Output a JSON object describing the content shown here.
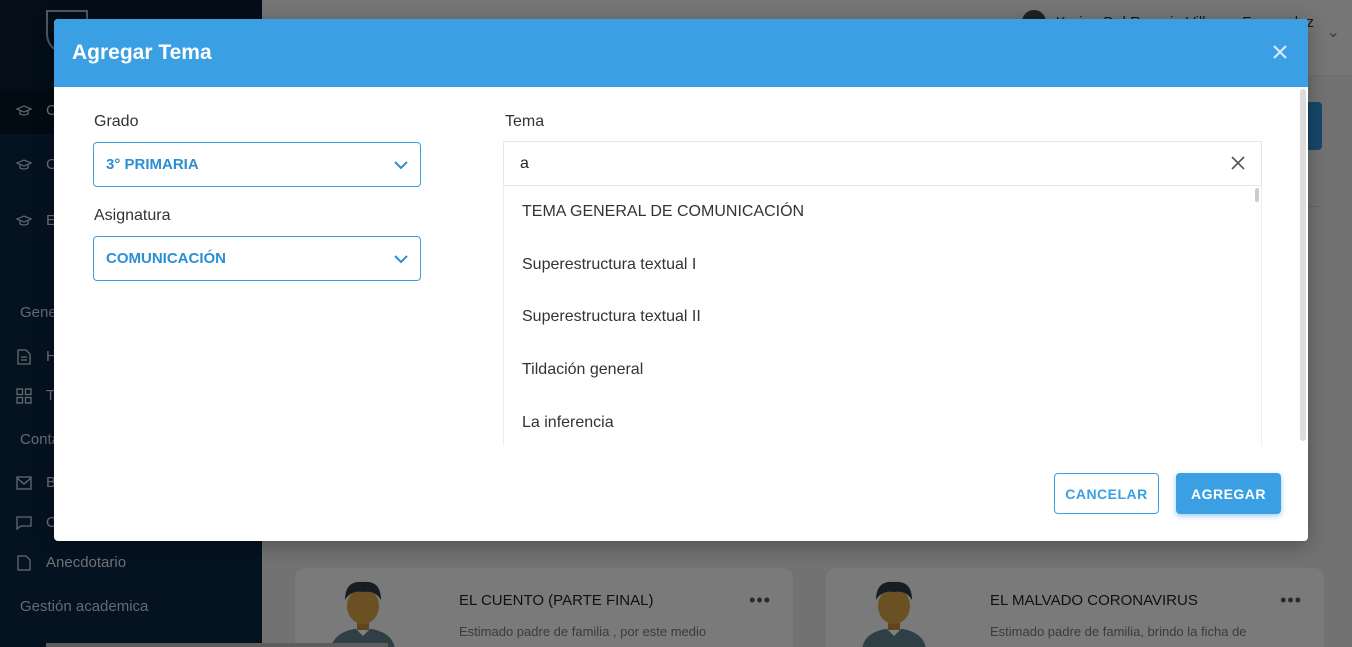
{
  "background": {
    "user_name": "Karina Del Rosario Villegas Fernandez",
    "sidebar": {
      "items": [
        {
          "label": "C",
          "icon": "graduation-cap-icon"
        },
        {
          "label": "C",
          "icon": "graduation-cap-icon"
        },
        {
          "label": "E",
          "icon": "graduation-cap-icon"
        }
      ],
      "section_general": "Gene",
      "general_items": [
        {
          "label": "H",
          "icon": "document-icon"
        },
        {
          "label": "T",
          "icon": "grid-icon"
        }
      ],
      "section_contact": "Conta",
      "contact_items": [
        {
          "label": "B",
          "icon": "mail-icon"
        },
        {
          "label": "C",
          "icon": "chat-icon"
        },
        {
          "label": "Anecdotario",
          "icon": "file-icon"
        }
      ],
      "section_academic": "Gestión academica"
    },
    "cards": [
      {
        "title": "EL CUENTO (PARTE FINAL)",
        "desc": "Estimado padre de familia , por este medio"
      },
      {
        "title": "EL MALVADO CORONAVIRUS",
        "desc": "Estimado padre de familia, brindo la ficha de"
      }
    ]
  },
  "modal": {
    "title": "Agregar Tema",
    "grado": {
      "label": "Grado",
      "value": "3° PRIMARIA"
    },
    "asignatura": {
      "label": "Asignatura",
      "value": "COMUNICACIÓN"
    },
    "tema": {
      "label": "Tema",
      "search_value": "a",
      "options": [
        "TEMA GENERAL DE COMUNICACIÓN",
        "Superestructura textual I",
        "Superestructura textual II",
        "Tildación general",
        "La inferencia"
      ]
    },
    "cancel_label": "CANCELAR",
    "add_label": "AGREGAR"
  },
  "colors": {
    "accent": "#3aa0e3",
    "sidebar": "#0a2540"
  }
}
